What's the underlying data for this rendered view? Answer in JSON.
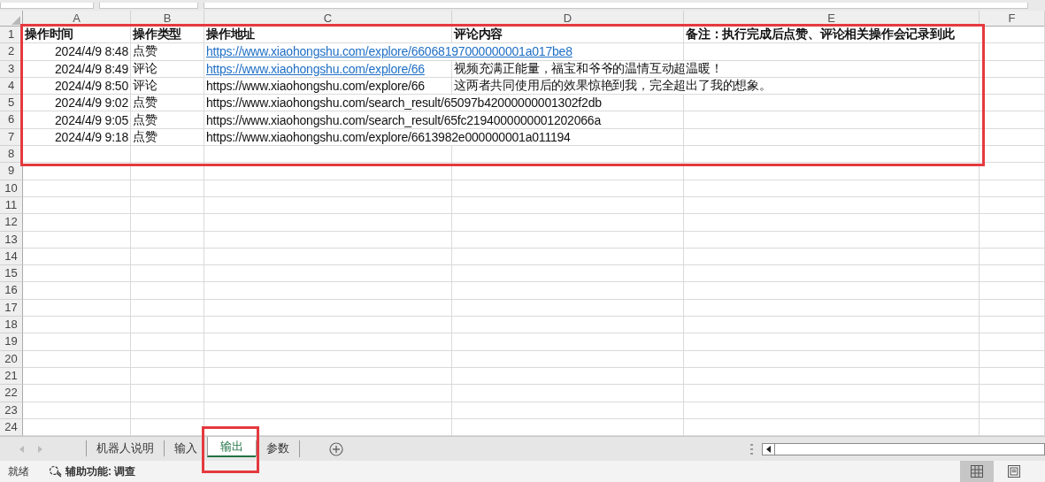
{
  "sheet": {
    "framed": true,
    "columns": [
      "A",
      "B",
      "C",
      "D",
      "E",
      "F"
    ],
    "row_numbers": [
      "1",
      "2",
      "3",
      "4",
      "5",
      "6",
      "7",
      "8",
      "9",
      "10",
      "11",
      "12",
      "13",
      "14",
      "15",
      "16",
      "17",
      "18",
      "19",
      "20",
      "21",
      "22",
      "23",
      "24"
    ],
    "rows": [
      [
        {
          "kind": "header",
          "text": "操作时间"
        },
        {
          "kind": "header",
          "text": "操作类型"
        },
        {
          "kind": "header",
          "text": "操作地址"
        },
        {
          "kind": "header",
          "text": "评论内容"
        },
        {
          "kind": "header",
          "text": "备注：执行完成后点赞、评论相关操作会记录到此"
        }
      ],
      [
        {
          "kind": "date",
          "text": "2024/4/9 8:48"
        },
        {
          "kind": "text",
          "text": "点赞"
        },
        {
          "kind": "link",
          "text": "https://www.xiaohongshu.com/explore/66068197000000001a017be8"
        }
      ],
      [
        {
          "kind": "date",
          "text": "2024/4/9 8:49"
        },
        {
          "kind": "text",
          "text": "评论"
        },
        {
          "kind": "link",
          "text": "https://www.xiaohongshu.com/explore/66"
        },
        {
          "kind": "text",
          "text": "视频充满正能量，福宝和爷爷的温情互动超温暖！"
        }
      ],
      [
        {
          "kind": "date",
          "text": "2024/4/9 8:50"
        },
        {
          "kind": "text",
          "text": "评论"
        },
        {
          "kind": "text",
          "text": "https://www.xiaohongshu.com/explore/66"
        },
        {
          "kind": "text",
          "text": "这两者共同使用后的效果惊艳到我，完全超出了我的想象。"
        }
      ],
      [
        {
          "kind": "date",
          "text": "2024/4/9 9:02"
        },
        {
          "kind": "text",
          "text": "点赞"
        },
        {
          "kind": "text",
          "text": "https://www.xiaohongshu.com/search_result/65097b42000000001302f2db"
        }
      ],
      [
        {
          "kind": "date",
          "text": "2024/4/9 9:05"
        },
        {
          "kind": "text",
          "text": "点赞"
        },
        {
          "kind": "text",
          "text": "https://www.xiaohongshu.com/search_result/65fc2194000000001202066a"
        }
      ],
      [
        {
          "kind": "date",
          "text": "2024/4/9 9:18"
        },
        {
          "kind": "text",
          "text": "点赞"
        },
        {
          "kind": "text",
          "text": "https://www.xiaohongshu.com/explore/6613982e000000001a011194"
        }
      ]
    ]
  },
  "sheet_tabs": [
    {
      "label": "机器人说明",
      "selected": false,
      "framed": false
    },
    {
      "label": "输入",
      "selected": false,
      "framed": false
    },
    {
      "label": "输出",
      "selected": true,
      "framed": true
    },
    {
      "label": "参数",
      "selected": false,
      "framed": false
    }
  ],
  "status_bar": {
    "status": "就绪",
    "accessibility": "辅助功能: 调查",
    "views": [
      {
        "kind": "normal",
        "selected": true
      },
      {
        "kind": "page",
        "selected": false
      }
    ]
  }
}
